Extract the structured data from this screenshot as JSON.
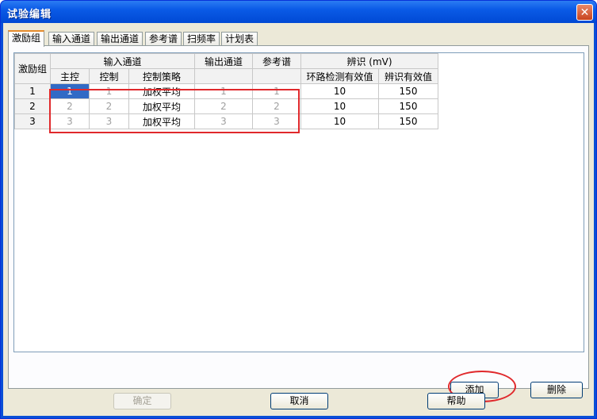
{
  "window": {
    "title": "试验编辑",
    "close_glyph": "✕"
  },
  "tabs": [
    {
      "label": "激励组",
      "active": true
    },
    {
      "label": "输入通道",
      "active": false
    },
    {
      "label": "输出通道",
      "active": false
    },
    {
      "label": "参考谱",
      "active": false
    },
    {
      "label": "扫频率",
      "active": false
    },
    {
      "label": "计划表",
      "active": false
    }
  ],
  "table": {
    "group_header": "激励组",
    "input_channel_header": "输入通道",
    "output_channel_header": "输出通道",
    "reference_header": "参考谱",
    "discrimination_header": "辨识 (mV)",
    "sub_headers": [
      "主控",
      "控制",
      "控制策略",
      "环路检测有效值",
      "辨识有效值"
    ],
    "rows": [
      {
        "group": "1",
        "master": "1",
        "control": "1",
        "strategy": "加权平均",
        "output": "1",
        "reference": "1",
        "loop_rms": "10",
        "ident_rms": "150"
      },
      {
        "group": "2",
        "master": "2",
        "control": "2",
        "strategy": "加权平均",
        "output": "2",
        "reference": "2",
        "loop_rms": "10",
        "ident_rms": "150"
      },
      {
        "group": "3",
        "master": "3",
        "control": "3",
        "strategy": "加权平均",
        "output": "3",
        "reference": "3",
        "loop_rms": "10",
        "ident_rms": "150"
      }
    ]
  },
  "buttons": {
    "add": "添加",
    "delete": "删除",
    "ok": "确定",
    "cancel": "取消",
    "help": "帮助"
  },
  "colors": {
    "titlebar": "#0a5ae6",
    "selection": "#316ac5",
    "annotation": "#e0292c",
    "tab_highlight": "#e68b2c"
  }
}
